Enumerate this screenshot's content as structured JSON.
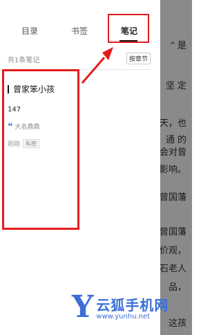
{
  "tabs": [
    {
      "label": "目录",
      "active": false
    },
    {
      "label": "书签",
      "active": false
    },
    {
      "label": "笔记",
      "active": true
    }
  ],
  "notes_header": {
    "count_label": "共1条笔记",
    "sort_button_label": "按章节"
  },
  "note": {
    "title": "曾家笨小孩",
    "count": "147",
    "quote": "大名鼎鼎",
    "time": "刚刚",
    "privacy_badge": "私密"
  },
  "reader_text": [
    "“ 是",
    "坚 定",
    "天，也",
    "通 的",
    "会对曾",
    "影响。",
    "曾国藩",
    "曾国藩",
    "价观，",
    "石老人",
    "品，",
    "这孩"
  ],
  "watermark": {
    "letter": "Y",
    "name": "云狐手机网",
    "url": "www.yunhu.net"
  },
  "colors": {
    "annotation_red": "#e31b1b",
    "quote_icon_blue": "#4a90d9",
    "watermark_blue": "#3b6fd6",
    "overlay_gray": "#8a8a8a"
  }
}
